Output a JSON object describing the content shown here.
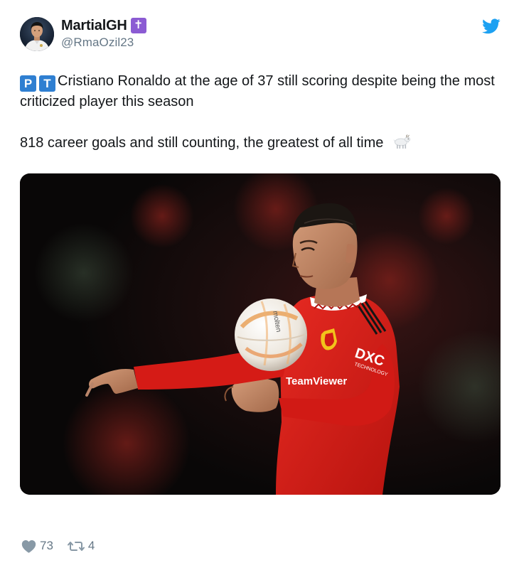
{
  "tweet": {
    "author": {
      "display_name": "MartialGH",
      "badge_glyph": "✝",
      "handle": "@RmaOzil23",
      "avatar_icon": "avatar-photo-icon"
    },
    "brand_icon": "twitter-bird-icon",
    "text": {
      "flag_letters": [
        "P",
        "T"
      ],
      "line1": "Cristiano Ronaldo at the age of 37 still scoring despite being the most criticized player this season",
      "line2": "818 career goals and still counting, the greatest of all time",
      "line2_emoji": "goat-emoji"
    },
    "media": {
      "kind": "photo",
      "sponsor_text": "TeamViewer",
      "sleeve_text": "DXC",
      "sleeve_subtext": "TECHNOLOGY",
      "ball_text": "molten"
    },
    "actions": {
      "likes": "73",
      "retweets": "4"
    }
  },
  "colors": {
    "brand_blue": "#1da1f2",
    "text_primary": "#14171a",
    "text_secondary": "#657786",
    "flag_blue": "#2f7fd1",
    "badge_purple": "#8b5bd3",
    "jersey_red": "#d81d1d"
  }
}
